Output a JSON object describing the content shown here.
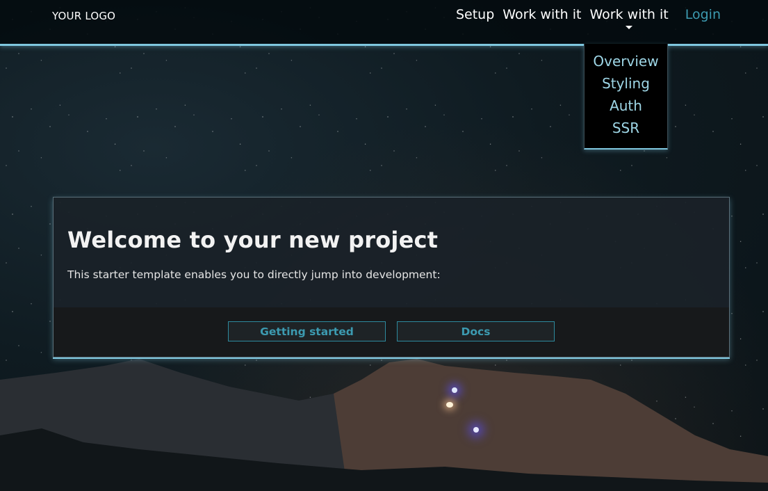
{
  "header": {
    "logo": "YOUR LOGO",
    "nav": {
      "setup": "Setup",
      "work1": "Work with it",
      "work2": "Work with it",
      "login": "Login"
    }
  },
  "dropdown": {
    "items": [
      "Overview",
      "Styling",
      "Auth",
      "SSR"
    ]
  },
  "card": {
    "title": "Welcome to your new project",
    "text": "This starter template enables you to directly jump into development:",
    "buttons": {
      "getting_started": "Getting started",
      "docs": "Docs"
    }
  },
  "colors": {
    "accent": "#7fc7df",
    "link": "#3c9ab0",
    "dropdown_text": "#9ed6e6"
  }
}
